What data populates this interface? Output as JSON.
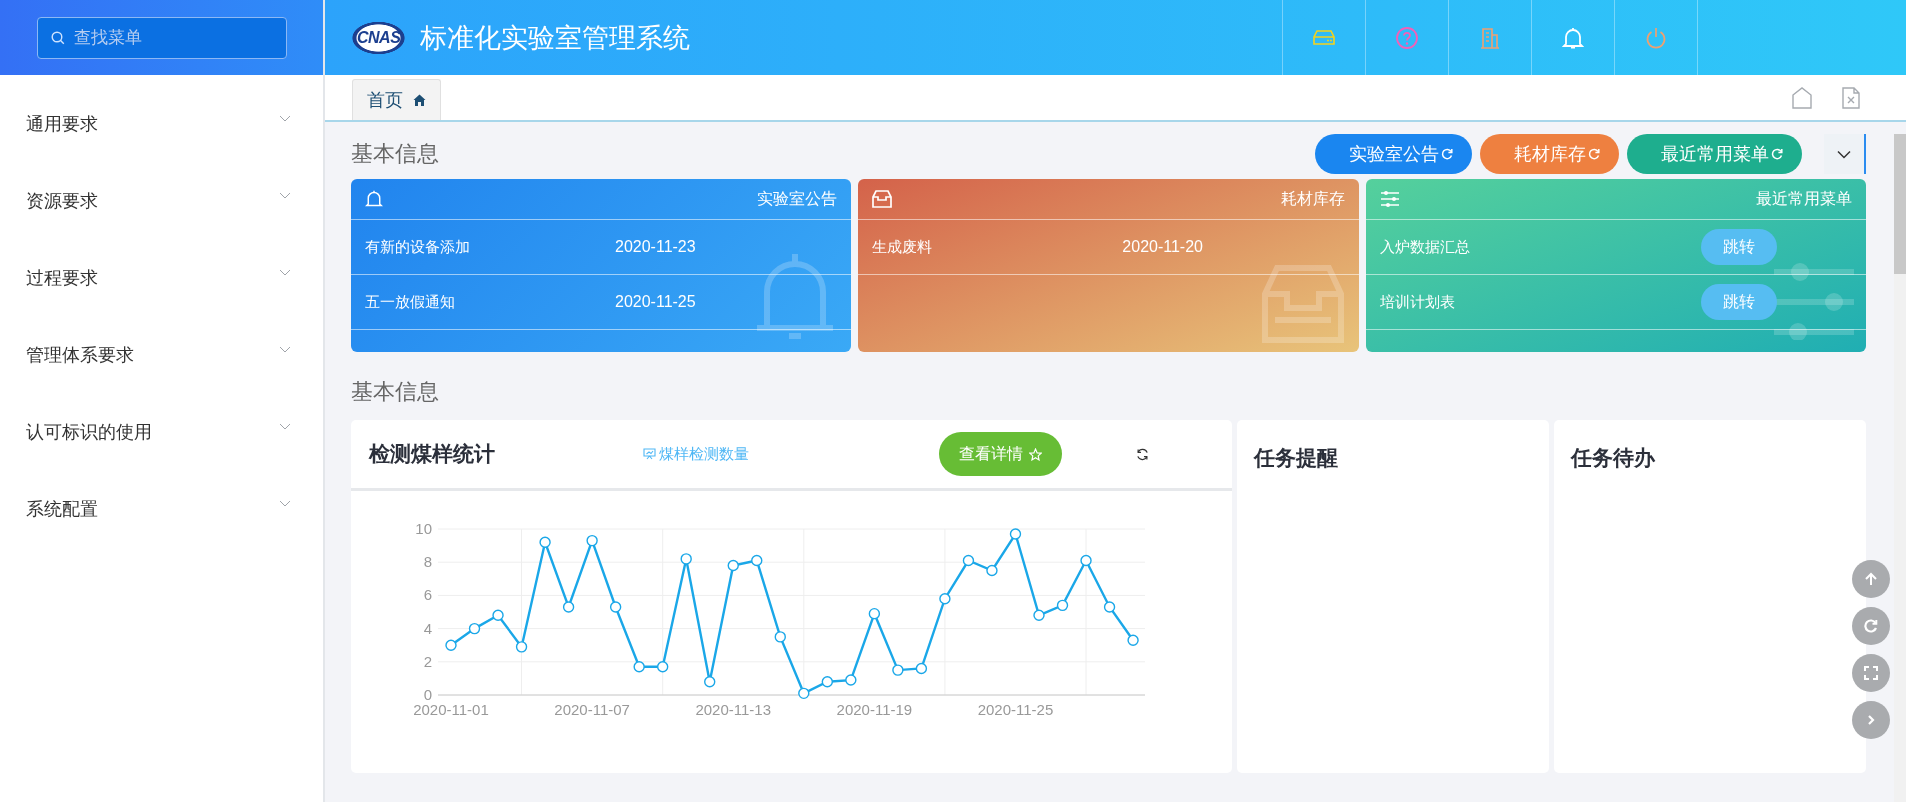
{
  "sidebar": {
    "search": {
      "placeholder": "查找菜单"
    },
    "items": [
      {
        "label": "通用要求",
        "expanded": false
      },
      {
        "label": "资源要求",
        "expanded": false
      },
      {
        "label": "过程要求",
        "expanded": false
      },
      {
        "label": "管理体系要求",
        "expanded": false
      },
      {
        "label": "认可标识的使用",
        "expanded": false
      },
      {
        "label": "系统配置",
        "expanded": false
      }
    ]
  },
  "header": {
    "logo": "CNAS",
    "title": "标准化实验室管理系统"
  },
  "tabs": [
    {
      "label": "首页",
      "selected": true
    }
  ],
  "section_title": "基本信息",
  "quick_buttons": [
    {
      "label": "实验室公告",
      "color": "#1a86f0"
    },
    {
      "label": "耗材库存",
      "color": "#ee8040"
    },
    {
      "label": "最近常用菜单",
      "color": "#1eae8e"
    }
  ],
  "cards": [
    {
      "kind": "notice",
      "title": "实验室公告",
      "rows": [
        {
          "text": "有新的设备添加",
          "date": "2020-11-23"
        },
        {
          "text": "五一放假通知",
          "date": "2020-11-25"
        }
      ]
    },
    {
      "kind": "stock",
      "title": "耗材库存",
      "rows": [
        {
          "text": "生成废料",
          "date": "2020-11-20"
        }
      ]
    },
    {
      "kind": "menu",
      "title": "最近常用菜单",
      "rows": [
        {
          "text": "入炉数据汇总",
          "action": "跳转"
        },
        {
          "text": "培训计划表",
          "action": "跳转"
        }
      ]
    }
  ],
  "section2_title": "基本信息",
  "chart_panel": {
    "title": "检测煤样统计",
    "details_button": "查看详情",
    "chart_data": {
      "type": "line",
      "categories": [
        "2020-11-01",
        null,
        null,
        null,
        null,
        null,
        "2020-11-07",
        null,
        null,
        null,
        null,
        null,
        "2020-11-13",
        null,
        null,
        null,
        null,
        null,
        "2020-11-19",
        null,
        null,
        null,
        null,
        null,
        "2020-11-25",
        null,
        null,
        null,
        null,
        null
      ],
      "grid": true,
      "series": [
        {
          "name": "煤样检测数量",
          "color": "#1aa7e8",
          "marker": true,
          "values": [
            3,
            4,
            4.8,
            2.9,
            9.2,
            5.3,
            9.3,
            5.3,
            1.7,
            1.7,
            8.2,
            0.8,
            7.8,
            8.1,
            3.5,
            0.1,
            0.8,
            0.9,
            4.9,
            1.5,
            1.6,
            5.8,
            8.1,
            7.5,
            9.7,
            4.8,
            5.4,
            8.1,
            5.3,
            3.3
          ]
        }
      ],
      "ylim": [
        0,
        10
      ],
      "yticks": [
        0,
        2,
        4,
        6,
        8,
        10
      ]
    }
  },
  "task_panels": [
    {
      "title": "任务提醒"
    },
    {
      "title": "任务待办"
    }
  ]
}
